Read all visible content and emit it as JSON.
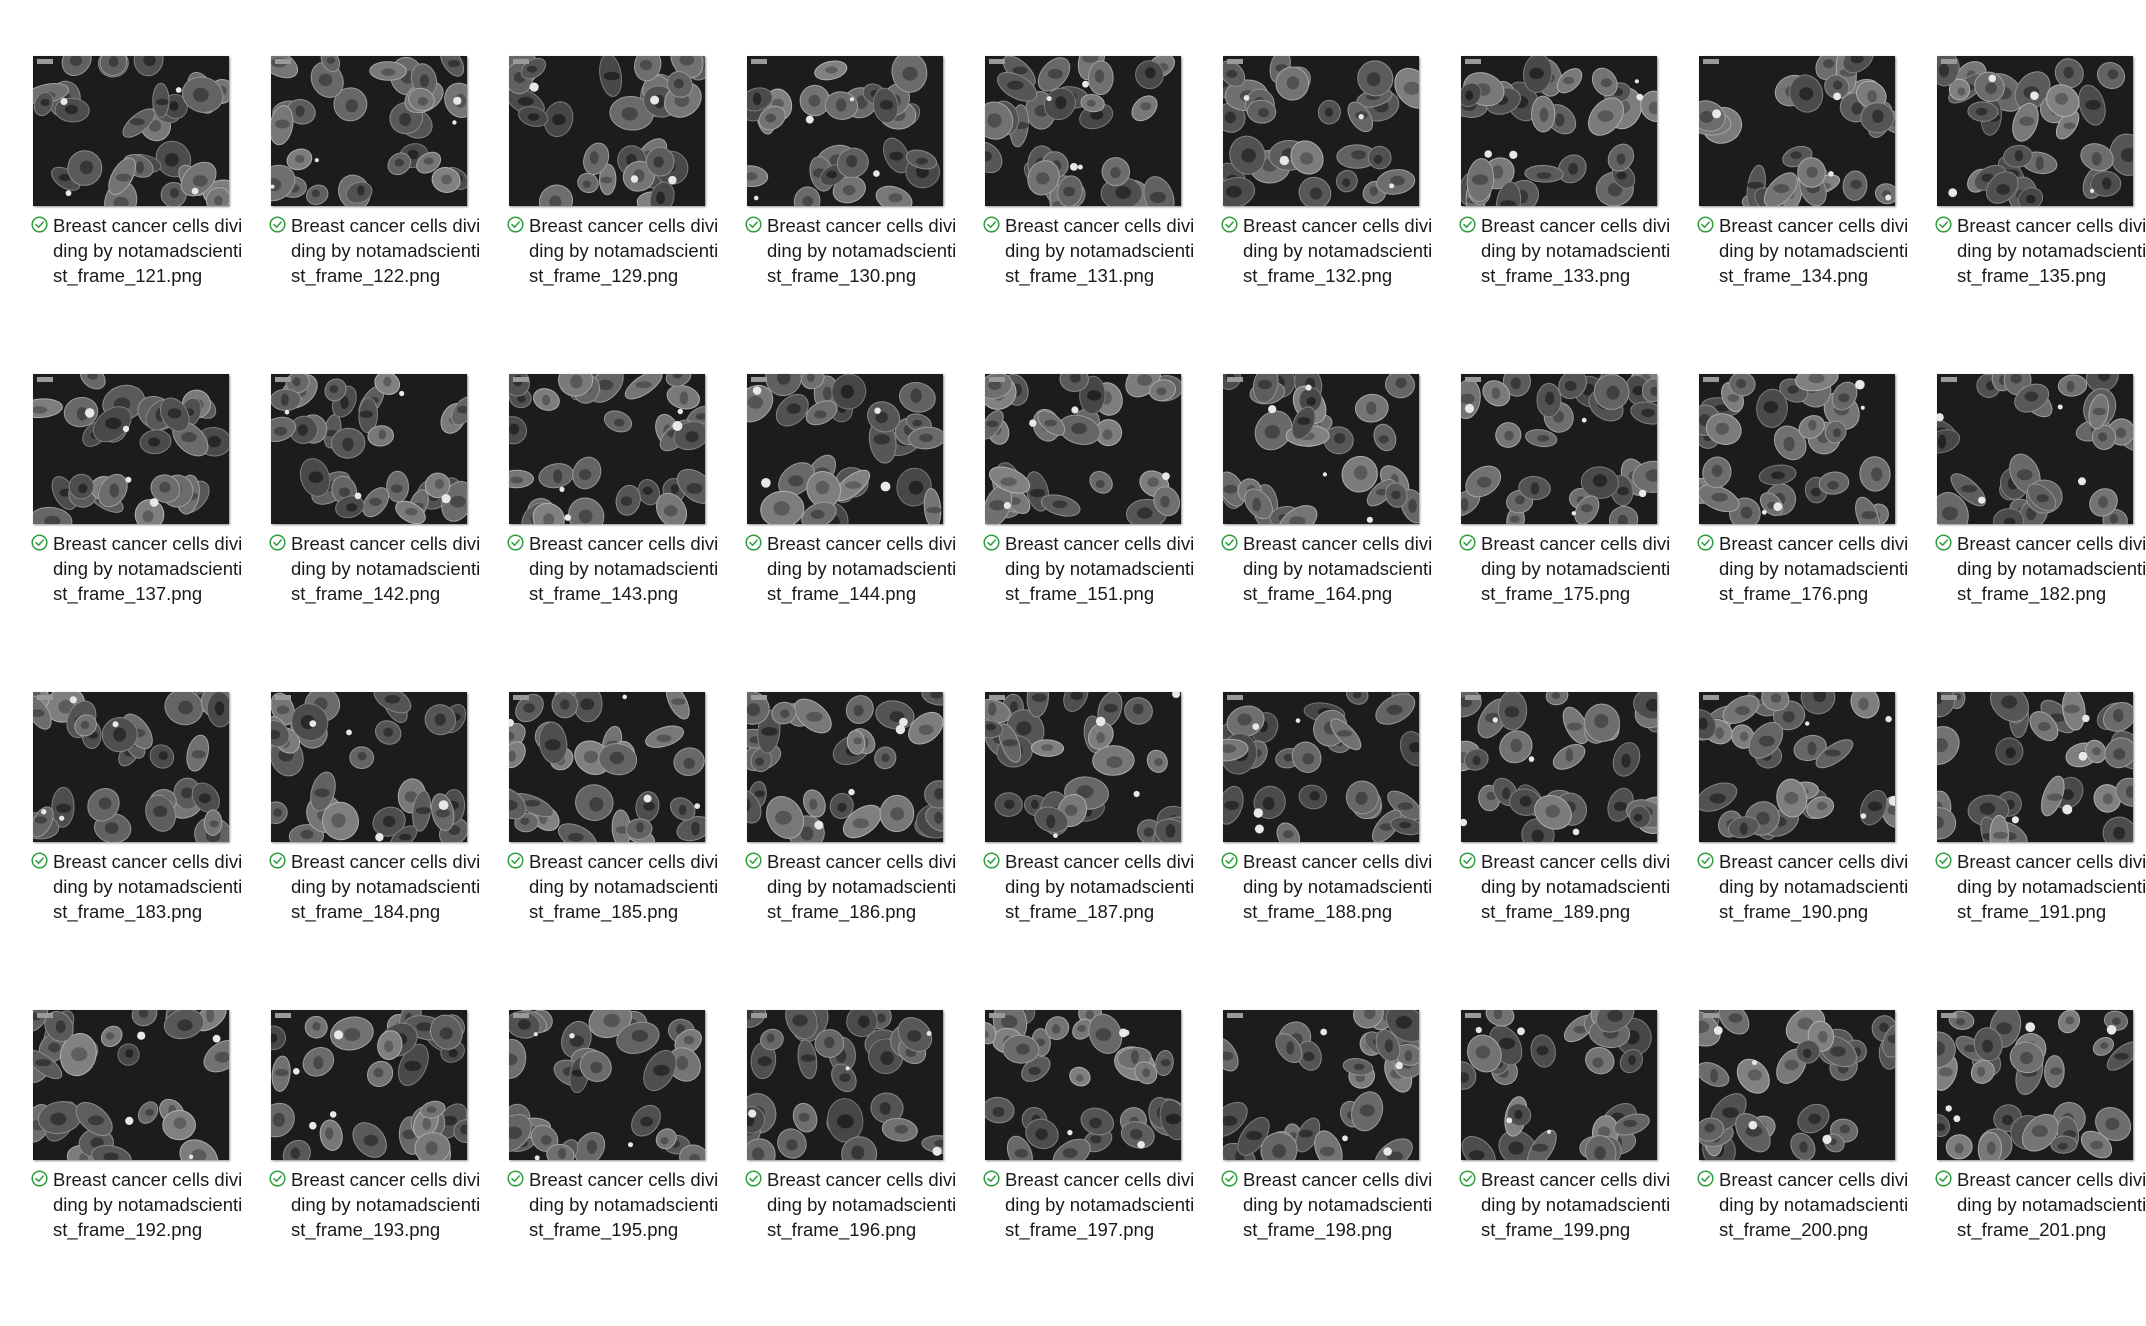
{
  "status_icon": "synced-check-icon",
  "colors": {
    "check_green": "#2e9e3e",
    "thumb_bg": "#1c1c1c",
    "label_text": "#1a1a1a"
  },
  "files": [
    {
      "name": "Breast cancer cells dividing by notamadscientist_frame_121.png"
    },
    {
      "name": "Breast cancer cells dividing by notamadscientist_frame_122.png"
    },
    {
      "name": "Breast cancer cells dividing by notamadscientist_frame_129.png"
    },
    {
      "name": "Breast cancer cells dividing by notamadscientist_frame_130.png"
    },
    {
      "name": "Breast cancer cells dividing by notamadscientist_frame_131.png"
    },
    {
      "name": "Breast cancer cells dividing by notamadscientist_frame_132.png"
    },
    {
      "name": "Breast cancer cells dividing by notamadscientist_frame_133.png"
    },
    {
      "name": "Breast cancer cells dividing by notamadscientist_frame_134.png"
    },
    {
      "name": "Breast cancer cells dividing by notamadscientist_frame_135.png"
    },
    {
      "name": "Breast cancer cells dividing by notamadscientist_frame_137.png"
    },
    {
      "name": "Breast cancer cells dividing by notamadscientist_frame_142.png"
    },
    {
      "name": "Breast cancer cells dividing by notamadscientist_frame_143.png"
    },
    {
      "name": "Breast cancer cells dividing by notamadscientist_frame_144.png"
    },
    {
      "name": "Breast cancer cells dividing by notamadscientist_frame_151.png"
    },
    {
      "name": "Breast cancer cells dividing by notamadscientist_frame_164.png"
    },
    {
      "name": "Breast cancer cells dividing by notamadscientist_frame_175.png"
    },
    {
      "name": "Breast cancer cells dividing by notamadscientist_frame_176.png"
    },
    {
      "name": "Breast cancer cells dividing by notamadscientist_frame_182.png"
    },
    {
      "name": "Breast cancer cells dividing by notamadscientist_frame_183.png"
    },
    {
      "name": "Breast cancer cells dividing by notamadscientist_frame_184.png"
    },
    {
      "name": "Breast cancer cells dividing by notamadscientist_frame_185.png"
    },
    {
      "name": "Breast cancer cells dividing by notamadscientist_frame_186.png"
    },
    {
      "name": "Breast cancer cells dividing by notamadscientist_frame_187.png"
    },
    {
      "name": "Breast cancer cells dividing by notamadscientist_frame_188.png"
    },
    {
      "name": "Breast cancer cells dividing by notamadscientist_frame_189.png"
    },
    {
      "name": "Breast cancer cells dividing by notamadscientist_frame_190.png"
    },
    {
      "name": "Breast cancer cells dividing by notamadscientist_frame_191.png"
    },
    {
      "name": "Breast cancer cells dividing by notamadscientist_frame_192.png"
    },
    {
      "name": "Breast cancer cells dividing by notamadscientist_frame_193.png"
    },
    {
      "name": "Breast cancer cells dividing by notamadscientist_frame_195.png"
    },
    {
      "name": "Breast cancer cells dividing by notamadscientist_frame_196.png"
    },
    {
      "name": "Breast cancer cells dividing by notamadscientist_frame_197.png"
    },
    {
      "name": "Breast cancer cells dividing by notamadscientist_frame_198.png"
    },
    {
      "name": "Breast cancer cells dividing by notamadscientist_frame_199.png"
    },
    {
      "name": "Breast cancer cells dividing by notamadscientist_frame_200.png"
    },
    {
      "name": "Breast cancer cells dividing by notamadscientist_frame_201.png"
    }
  ]
}
